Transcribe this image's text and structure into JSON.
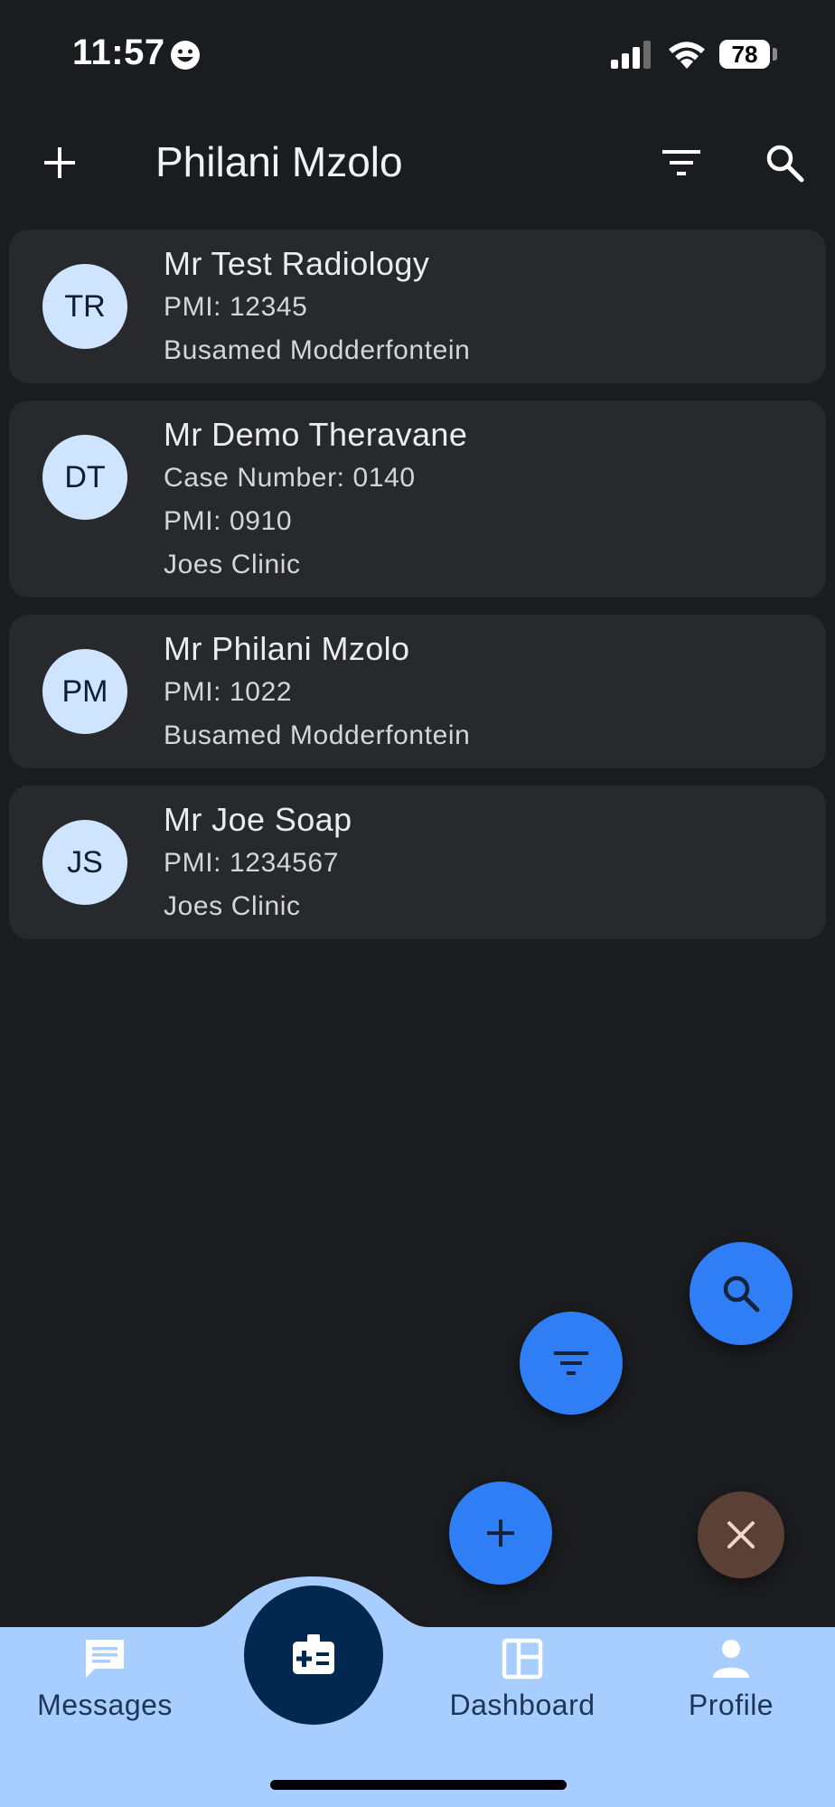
{
  "status_bar": {
    "time": "11:57",
    "battery": "78"
  },
  "app_bar": {
    "title": "Philani Mzolo",
    "icons": [
      "add-icon",
      "filter-icon",
      "search-icon"
    ]
  },
  "patients": [
    {
      "initials": "TR",
      "name": "Mr Test Radiology",
      "lines": [
        "PMI: 12345",
        "Busamed Modderfontein"
      ]
    },
    {
      "initials": "DT",
      "name": "Mr Demo Theravane",
      "lines": [
        "Case Number: 0140",
        "PMI: 0910",
        "Joes Clinic"
      ]
    },
    {
      "initials": "PM",
      "name": "Mr Philani Mzolo",
      "lines": [
        "PMI: 1022",
        "Busamed Modderfontein"
      ]
    },
    {
      "initials": "JS",
      "name": "Mr Joe Soap",
      "lines": [
        "PMI: 1234567",
        "Joes Clinic"
      ]
    }
  ],
  "fab_menu": {
    "icons": [
      "search-icon",
      "filter-icon",
      "add-icon",
      "close-icon"
    ]
  },
  "bottom_nav": {
    "items": [
      {
        "label": "Messages",
        "icon": "message-icon"
      },
      {
        "label": "Dashboard",
        "icon": "dashboard-icon"
      },
      {
        "label": "Profile",
        "icon": "person-icon"
      }
    ],
    "center_icon": "medical-id-icon"
  },
  "colors": {
    "background": "#1b1c1f",
    "card": "#28292d",
    "avatar": "#cfe4ff",
    "accent": "#2f7ef6",
    "nav": "#a8cdff",
    "nav_center": "#03284f",
    "close_fab": "#5b4036"
  }
}
